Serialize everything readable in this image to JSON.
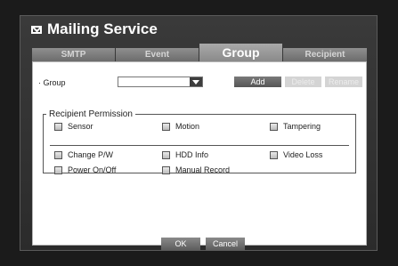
{
  "window": {
    "title": "Mailing Service"
  },
  "tabs": [
    {
      "label": "SMTP",
      "active": false
    },
    {
      "label": "Event",
      "active": false
    },
    {
      "label": "Group",
      "active": true
    },
    {
      "label": "Recipient",
      "active": false
    }
  ],
  "group": {
    "label": "· Group",
    "selected_value": "",
    "add_label": "Add",
    "delete_label": "Delete",
    "rename_label": "Rename"
  },
  "permissions": {
    "legend": "Recipient Permission",
    "items": [
      {
        "label": "Sensor",
        "checked": false
      },
      {
        "label": "Motion",
        "checked": false
      },
      {
        "label": "Tampering",
        "checked": false
      },
      {
        "label": "Change P/W",
        "checked": false
      },
      {
        "label": "HDD Info",
        "checked": false
      },
      {
        "label": "Video Loss",
        "checked": false
      },
      {
        "label": "Power On/Off",
        "checked": false
      },
      {
        "label": "Manual Record",
        "checked": false
      }
    ]
  },
  "footer": {
    "ok_label": "OK",
    "cancel_label": "Cancel"
  },
  "icons": {
    "title_icon": "mail-icon",
    "dropdown_icon": "chevron-down-icon"
  },
  "colors": {
    "background": "#1b1b1b",
    "active_tab": "#a9a9a9",
    "panel": "#ffffff"
  }
}
